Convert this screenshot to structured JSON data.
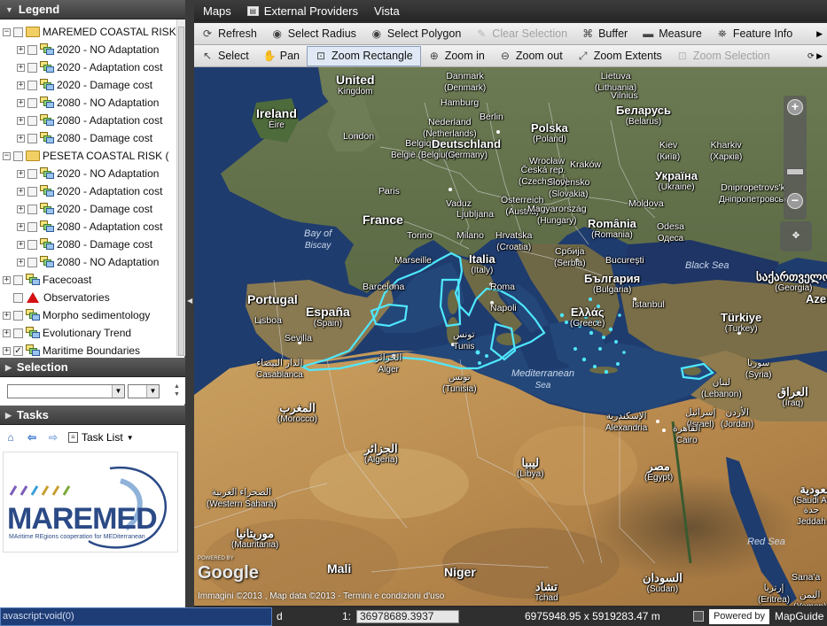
{
  "legend": {
    "title": "Legend",
    "items": [
      {
        "label": "MAREMED COASTAL RISK",
        "kind": "folder",
        "level": 0,
        "expanded": true,
        "checked": false
      },
      {
        "label": "2020 - NO Adaptation",
        "kind": "layer",
        "level": 1,
        "checked": false
      },
      {
        "label": "2020 - Adaptation cost",
        "kind": "layer",
        "level": 1,
        "checked": false
      },
      {
        "label": "2020 - Damage cost",
        "kind": "layer",
        "level": 1,
        "checked": false
      },
      {
        "label": "2080 - NO Adaptation",
        "kind": "layer",
        "level": 1,
        "checked": false
      },
      {
        "label": "2080 - Adaptation cost",
        "kind": "layer",
        "level": 1,
        "checked": false
      },
      {
        "label": "2080 - Damage cost",
        "kind": "layer",
        "level": 1,
        "checked": false
      },
      {
        "label": "PESETA COASTAL RISK (",
        "kind": "folder",
        "level": 0,
        "expanded": true,
        "checked": false
      },
      {
        "label": "2020 - NO Adaptation",
        "kind": "layer",
        "level": 1,
        "checked": false
      },
      {
        "label": "2020 - Adaptation cost",
        "kind": "layer",
        "level": 1,
        "checked": false
      },
      {
        "label": "2020 - Damage cost",
        "kind": "layer",
        "level": 1,
        "checked": false
      },
      {
        "label": "2080 - Adaptation cost",
        "kind": "layer",
        "level": 1,
        "checked": false
      },
      {
        "label": "2080 - Damage cost",
        "kind": "layer",
        "level": 1,
        "checked": false
      },
      {
        "label": "2080 - NO Adaptation",
        "kind": "layer",
        "level": 1,
        "checked": false
      },
      {
        "label": "Facecoast",
        "kind": "layer",
        "level": 0,
        "checked": false
      },
      {
        "label": "Observatories",
        "kind": "point",
        "level": 0,
        "checked": false
      },
      {
        "label": "Morpho sedimentology",
        "kind": "layer",
        "level": 0,
        "checked": false
      },
      {
        "label": "Evolutionary Trend",
        "kind": "layer",
        "level": 0,
        "checked": false
      },
      {
        "label": "Maritime Boundaries",
        "kind": "layer",
        "level": 0,
        "checked": true
      }
    ]
  },
  "selection": {
    "title": "Selection"
  },
  "tasks": {
    "title": "Tasks",
    "task_list_label": "Task List",
    "logo": {
      "name": "MAREMED",
      "tagline": "MAritime REgions cooperation for MEDiterranean"
    }
  },
  "menu": {
    "items": [
      "Maps",
      "External Providers",
      "Vista"
    ]
  },
  "toolbar1": [
    {
      "label": "Refresh",
      "icon": "refresh-icon",
      "glyph": "⟳",
      "enabled": true
    },
    {
      "label": "Select Radius",
      "icon": "select-radius-icon",
      "glyph": "◉",
      "enabled": true
    },
    {
      "label": "Select Polygon",
      "icon": "select-polygon-icon",
      "glyph": "◉",
      "enabled": true
    },
    {
      "label": "Clear Selection",
      "icon": "clear-selection-icon",
      "glyph": "✎",
      "enabled": false
    },
    {
      "label": "Buffer",
      "icon": "buffer-icon",
      "glyph": "⌘",
      "enabled": true
    },
    {
      "label": "Measure",
      "icon": "measure-icon",
      "glyph": "▬",
      "enabled": true
    },
    {
      "label": "Feature Info",
      "icon": "feature-info-icon",
      "glyph": "⛯",
      "enabled": true
    }
  ],
  "toolbar2": [
    {
      "label": "Select",
      "icon": "pointer-icon",
      "glyph": "↖",
      "enabled": true,
      "active": false
    },
    {
      "label": "Pan",
      "icon": "pan-icon",
      "glyph": "✋",
      "enabled": true,
      "active": false
    },
    {
      "label": "Zoom Rectangle",
      "icon": "zoom-rectangle-icon",
      "glyph": "⊡",
      "enabled": true,
      "active": true
    },
    {
      "label": "Zoom in",
      "icon": "zoom-in-icon",
      "glyph": "⊕",
      "enabled": true,
      "active": false
    },
    {
      "label": "Zoom out",
      "icon": "zoom-out-icon",
      "glyph": "⊖",
      "enabled": true,
      "active": false
    },
    {
      "label": "Zoom Extents",
      "icon": "zoom-extents-icon",
      "glyph": "⤢",
      "enabled": true,
      "active": false
    },
    {
      "label": "Zoom Selection",
      "icon": "zoom-selection-icon",
      "glyph": "⊡",
      "enabled": false,
      "active": false
    }
  ],
  "map": {
    "labels": [
      {
        "text": "United",
        "sub": "Kingdom",
        "cls": "big"
      },
      {
        "text": "Ireland",
        "sub": "Éire",
        "cls": "big"
      },
      {
        "text": "London",
        "cls": "city"
      },
      {
        "text": "Nederland",
        "sub": "(Netherlands)",
        "cls": "city"
      },
      {
        "text": "Belgique",
        "sub": "België (Belgium)",
        "cls": "city"
      },
      {
        "text": "Deutschland",
        "sub": "(Germany)",
        "cls": "mid"
      },
      {
        "text": "Hamburg",
        "cls": "city"
      },
      {
        "text": "Berlin",
        "cls": "city"
      },
      {
        "text": "Danmark",
        "sub": "(Denmark)",
        "cls": "city"
      },
      {
        "text": "Lietuva",
        "sub": "(Lithuania)",
        "cls": "city"
      },
      {
        "text": "Vilnius",
        "cls": "city"
      },
      {
        "text": "Беларусь",
        "sub": "(Belarus)",
        "cls": "mid"
      },
      {
        "text": "Polska",
        "sub": "(Poland)",
        "cls": "mid"
      },
      {
        "text": "Wrocław",
        "cls": "city"
      },
      {
        "text": "Kraków",
        "cls": "city"
      },
      {
        "text": "Kiev",
        "sub": "(Київ)",
        "cls": "city"
      },
      {
        "text": "Kharkiv",
        "sub": "(Харків)",
        "cls": "city"
      },
      {
        "text": "Україна",
        "sub": "(Ukraine)",
        "cls": "mid"
      },
      {
        "text": "Česká rep.",
        "sub": "(Czech Rep)",
        "cls": "city"
      },
      {
        "text": "Slovensko",
        "sub": "(Slovakia)",
        "cls": "city"
      },
      {
        "text": "Paris",
        "cls": "city"
      },
      {
        "text": "France",
        "cls": "big"
      },
      {
        "text": "Vaduz",
        "cls": "city"
      },
      {
        "text": "Österreich",
        "sub": "(Austria)",
        "cls": "city"
      },
      {
        "text": "Magyarország",
        "sub": "(Hungary)",
        "cls": "city"
      },
      {
        "text": "Moldova",
        "cls": "city"
      },
      {
        "text": "Dnipropetrovs'k",
        "sub": "Дніпропетровськ",
        "cls": "city"
      },
      {
        "text": "Ljubljana",
        "cls": "city"
      },
      {
        "text": "Hrvatska",
        "sub": "(Croatia)",
        "cls": "city"
      },
      {
        "text": "Torino",
        "cls": "city"
      },
      {
        "text": "Milano",
        "cls": "city"
      },
      {
        "text": "România",
        "sub": "(Romania)",
        "cls": "mid"
      },
      {
        "text": "Odesa",
        "sub": "Одеса",
        "cls": "city"
      },
      {
        "text": "Bay of",
        "sub": "Biscay",
        "cls": "sea"
      },
      {
        "text": "Marseille",
        "cls": "city"
      },
      {
        "text": "Italia",
        "sub": "(Italy)",
        "cls": "mid"
      },
      {
        "text": "Србија",
        "sub": "(Serbia)",
        "cls": "city"
      },
      {
        "text": "Bucureşti",
        "cls": "city"
      },
      {
        "text": "Black Sea",
        "cls": "sea"
      },
      {
        "text": "საქართველო",
        "sub": "(Georgia)",
        "cls": "mid"
      },
      {
        "text": "Portugal",
        "cls": "big"
      },
      {
        "text": "Barcelona",
        "cls": "city"
      },
      {
        "text": "Roma",
        "cls": "city"
      },
      {
        "text": "България",
        "sub": "(Bulgaria)",
        "cls": "mid"
      },
      {
        "text": "İstanbul",
        "cls": "city"
      },
      {
        "text": "España",
        "sub": "(Spain)",
        "cls": "big"
      },
      {
        "text": "Lisboa",
        "cls": "city"
      },
      {
        "text": "Napoli",
        "cls": "city"
      },
      {
        "text": "Ελλάς",
        "sub": "(Greece)",
        "cls": "mid"
      },
      {
        "text": "Türkiye",
        "sub": "(Turkey)",
        "cls": "mid"
      },
      {
        "text": "Sevilla",
        "cls": "city"
      },
      {
        "text": "تونس",
        "sub": "Tunis",
        "cls": "city"
      },
      {
        "text": "الدار البيضاء",
        "sub": "Casablanca",
        "cls": "city"
      },
      {
        "text": "الجزائر",
        "sub": "Alger",
        "cls": "city"
      },
      {
        "text": "تونس",
        "sub": "(Tunisia)",
        "cls": "city"
      },
      {
        "text": "Mediterranean",
        "sub": "Sea",
        "cls": "sea"
      },
      {
        "text": "سوريا",
        "sub": "(Syria)",
        "cls": "city"
      },
      {
        "text": "لبنان",
        "sub": "(Lebanon)",
        "cls": "city"
      },
      {
        "text": "العراق",
        "sub": "(Iraq)",
        "cls": "mid"
      },
      {
        "text": "المغرب",
        "sub": "(Morocco)",
        "cls": "mid"
      },
      {
        "text": "الإسكندرية",
        "sub": "Alexandria",
        "cls": "city"
      },
      {
        "text": "إسرائيل",
        "sub": "(Israel)",
        "cls": "city"
      },
      {
        "text": "الأردن",
        "sub": "(Jordan)",
        "cls": "city"
      },
      {
        "text": "القاهرة",
        "sub": "Cairo",
        "cls": "city"
      },
      {
        "text": "الجزائر",
        "sub": "(Algeria)",
        "cls": "mid"
      },
      {
        "text": "ليبيا",
        "sub": "(Libya)",
        "cls": "mid"
      },
      {
        "text": "مصر",
        "sub": "(Egypt)",
        "cls": "mid"
      },
      {
        "text": "الصحراء الغربية",
        "sub": "(Western Sahara)",
        "cls": "city"
      },
      {
        "text": "السعودية",
        "sub": "(Saudi Arabia)",
        "cls": "mid"
      },
      {
        "text": "جدة",
        "sub": "Jeddah",
        "cls": "city"
      },
      {
        "text": "Red Sea",
        "cls": "sea"
      },
      {
        "text": "موريتانيا",
        "sub": "(Mauritania)",
        "cls": "mid"
      },
      {
        "text": "Mali",
        "cls": "big"
      },
      {
        "text": "Niger",
        "cls": "big"
      },
      {
        "text": "تشاد",
        "sub": "Tchad",
        "cls": "mid"
      },
      {
        "text": "السودان",
        "sub": "(Sudan)",
        "cls": "mid"
      },
      {
        "text": "إرتريا",
        "sub": "(Eritrea)",
        "cls": "city"
      },
      {
        "text": "Sana'a",
        "cls": "city"
      },
      {
        "text": "اليمن",
        "sub": "(Yemen)",
        "cls": "city"
      },
      {
        "text": "Azerbaijan",
        "cls": "mid"
      }
    ],
    "google_label": "Google",
    "powered_label": "POWERED BY",
    "attribution": "Immagini ©2013 , Map data ©2013 - Termini e condizioni d'uso"
  },
  "status": {
    "js_text": "avascript:void(0)",
    "left_text": "d",
    "scale_prefix": "1:",
    "scale_value": "36978689.3937",
    "coords": "6975948.95 x 5919283.47 m",
    "powered_by": "Powered by",
    "mapguide": "MapGuide"
  },
  "colors": {
    "accent": "#1e3d76",
    "boundary": "#4fe8ff",
    "panel_header": "#454545"
  }
}
